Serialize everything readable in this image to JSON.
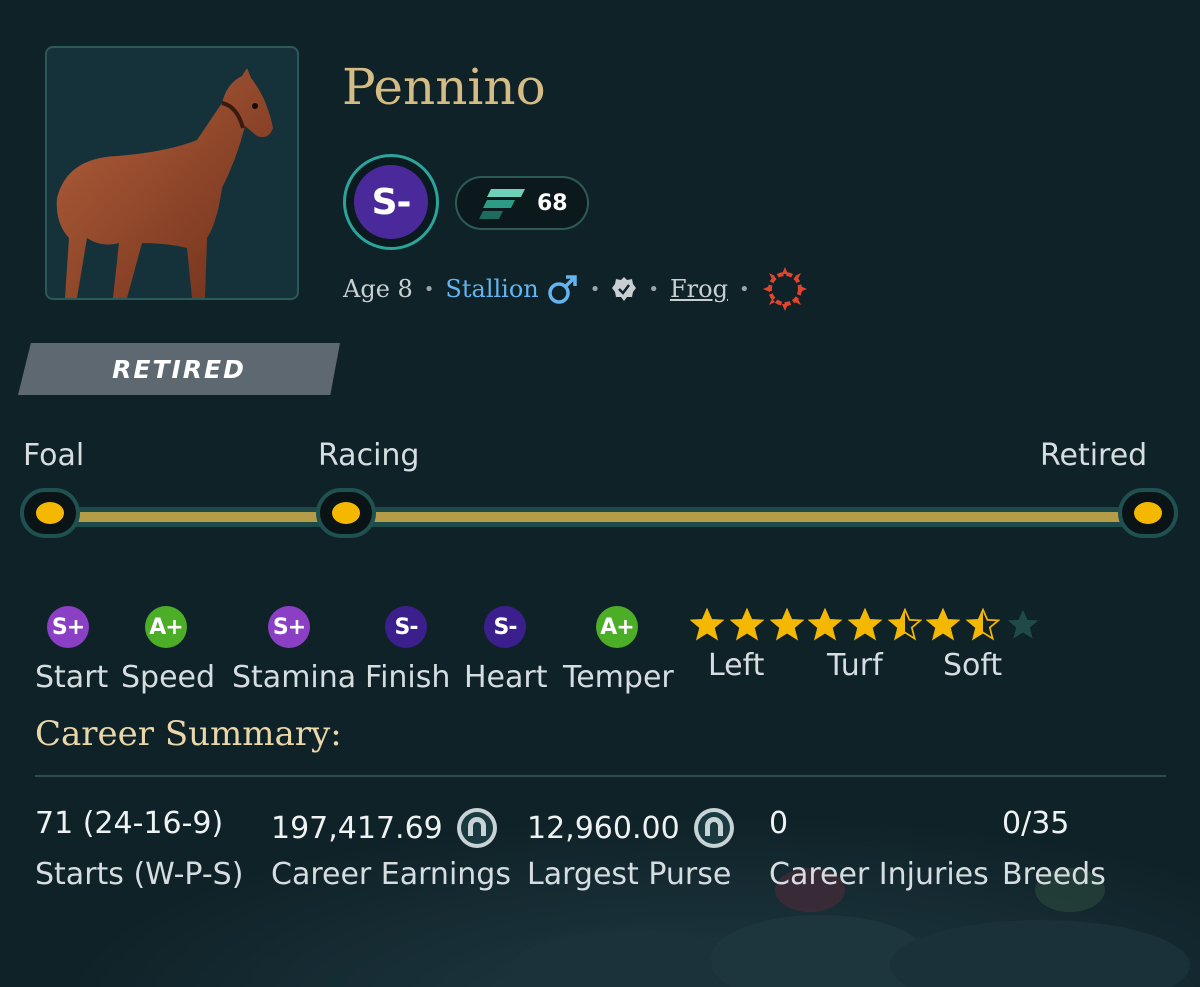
{
  "horse": {
    "name": "Pennino",
    "grade": "S-",
    "rating_value": "68",
    "age_text": "Age 8",
    "gender": "Stallion",
    "owner": "Frog",
    "status": "RETIRED"
  },
  "icons": {
    "portrait": "horse-portrait-image",
    "rating": "speed-rating-icon",
    "gender": "male-icon",
    "verified": "verified-badge-icon",
    "stable": "stable-emblem-icon",
    "currency": "horseshoe-coin-icon"
  },
  "timeline": {
    "stages": [
      {
        "label": "Foal"
      },
      {
        "label": "Racing"
      },
      {
        "label": "Retired"
      }
    ],
    "current_stage": "Retired"
  },
  "stats": [
    {
      "label": "Start",
      "grade": "S+",
      "color": "#8a3fc5"
    },
    {
      "label": "Speed",
      "grade": "A+",
      "color": "#4cae26"
    },
    {
      "label": "Stamina",
      "grade": "S+",
      "color": "#8a3fc5"
    },
    {
      "label": "Finish",
      "grade": "S-",
      "color": "#3b1f8c"
    },
    {
      "label": "Heart",
      "grade": "S-",
      "color": "#3b1f8c"
    },
    {
      "label": "Temper",
      "grade": "A+",
      "color": "#4cae26"
    }
  ],
  "preferences": [
    {
      "label": "Left",
      "stars": 3
    },
    {
      "label": "Turf",
      "stars": 2.5
    },
    {
      "label": "Soft",
      "stars": 1.5
    }
  ],
  "career": {
    "title": "Career Summary:",
    "items": [
      {
        "value": "71 (24-16-9)",
        "label": "Starts (W-P-S)"
      },
      {
        "value": "197,417.69",
        "label": "Career Earnings"
      },
      {
        "value": "12,960.00",
        "label": "Largest Purse"
      },
      {
        "value": "0",
        "label": "Career Injuries"
      },
      {
        "value": "0/35",
        "label": "Breeds"
      }
    ]
  },
  "colors": {
    "background": "#0f2228",
    "name_gold": "#d4bc84",
    "timeline_gold": "#b59c48",
    "node_yellow": "#f5b800",
    "star_yellow": "#f5b800",
    "link_blue": "#64b4f0",
    "emblem_red": "#e0452e"
  }
}
